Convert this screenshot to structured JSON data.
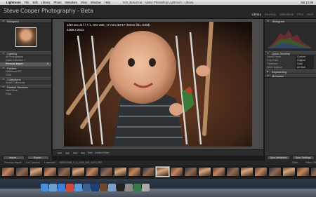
{
  "menubar": {
    "apple": "",
    "app": "Lightroom",
    "items": [
      "File",
      "Edit",
      "Library",
      "Photo",
      "Metadata",
      "View",
      "Window",
      "Help"
    ],
    "window_title": "ISO_Beta.lrcat - Adobe Photoshop Lightroom - Library",
    "right": [
      "Sat 12:48"
    ]
  },
  "header": {
    "identity_plate": "Steve Cooper Photography - Beta",
    "modules": [
      "Library",
      "Develop",
      "Slideshow",
      "Print",
      "Web"
    ],
    "active_module": "Library"
  },
  "left_panel": {
    "navigator_label": "Navigator",
    "catalog_label": "Catalog",
    "catalog_items": [
      {
        "label": "All Photographs",
        "count": ""
      },
      {
        "label": "Quick Collection +",
        "count": ""
      },
      {
        "label": "Previous Import",
        "count": "2"
      }
    ],
    "folders_label": "Folders",
    "folder_items": [
      {
        "label": "Macintosh HD",
        "count": ""
      },
      {
        "label": "2008",
        "count": ""
      }
    ],
    "collections_label": "Collections",
    "collection_items": [
      {
        "label": "Smart Collections",
        "count": ""
      }
    ],
    "publish_label": "Publish Services",
    "publish_items": [
      {
        "label": "Hard Drive",
        "count": ""
      },
      {
        "label": "Flickr",
        "count": ""
      }
    ],
    "import_label": "Import...",
    "export_label": "Export..."
  },
  "photo": {
    "info_line": "1/60 sec at f / 7.1, ISO 200, 17 mm (EF17-40mm f/4L USM)",
    "dims": "4368 x 2912"
  },
  "toolbar": {
    "sort_label": "Sort:",
    "sort_value": "Added Order"
  },
  "right_panel": {
    "histogram_label": "Histogram",
    "quick_develop_label": "Quick Develop",
    "saved_preset_label": "Saved Preset",
    "saved_preset_value": "Custom",
    "crop_label": "Crop Ratio",
    "crop_value": "Original",
    "treatment_label": "Treatment",
    "treatment_value": "Color",
    "wb_label": "White Balance",
    "wb_value": "As Shot",
    "keywording_label": "Keywording",
    "metadata_label": "Metadata",
    "sync_meta_label": "Sync Metadata",
    "sync_settings_label": "Sync Settings"
  },
  "filmstrip_bar": {
    "source": "Previous Import",
    "count": "1 of 2 photos",
    "selected": "1 selected",
    "filename": "MKR00398_0_0_1000_MG_4321.CR2",
    "filter_label": "Filter:",
    "filter_value": "Filters Off"
  },
  "filmstrip": {
    "thumbs": 26,
    "selected_index": 11
  },
  "dock": {
    "icons": [
      "finder",
      "mail",
      "safari",
      "ical",
      "itunes",
      "lightroom",
      "photoshop",
      "bridge",
      "preview",
      "terminal",
      "system-preferences",
      "time-machine",
      "trash"
    ]
  }
}
